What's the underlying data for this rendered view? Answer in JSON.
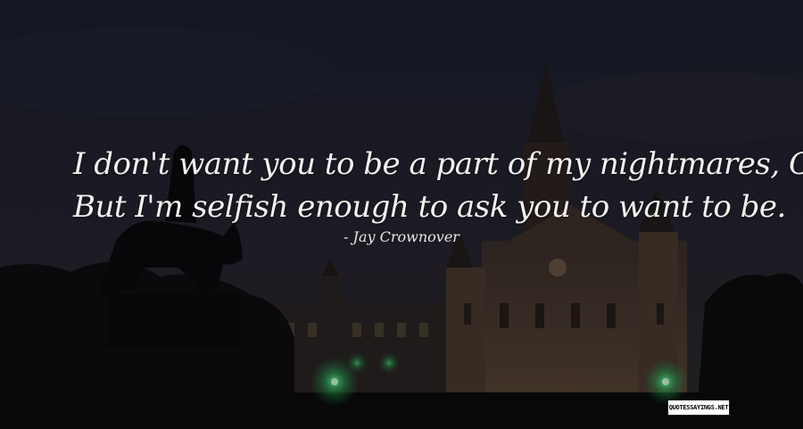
{
  "quote": {
    "line1": "I don't want you to be a part of my nightmares, Cora.",
    "line2": "But I'm selfish enough to ask you to want to be."
  },
  "author": "- Jay Crownover",
  "watermark": "QUOTESSAYINGS.NET",
  "colors": {
    "sky_top": "#1b1f2e",
    "sky_bottom": "#2e2a2e",
    "silhouette": "#0d0b0c",
    "building": "#4a3a30",
    "lamp": "#39e07a",
    "text": "#f3f1ee"
  }
}
